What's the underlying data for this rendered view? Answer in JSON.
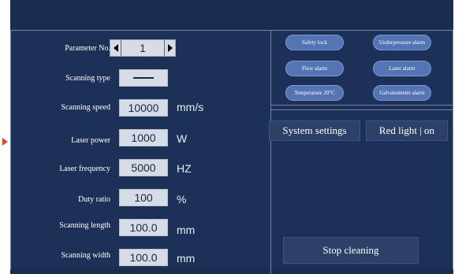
{
  "params": {
    "parameter_no": {
      "label": "Parameter No.",
      "value": "1"
    },
    "scanning_type": {
      "label": "Scanning type"
    },
    "rows": [
      {
        "label": "Scanning speed",
        "value": "10000",
        "unit": "mm/s"
      },
      {
        "label": "Laser power",
        "value": "1000",
        "unit": "W"
      },
      {
        "label": "Laser frequency",
        "value": "5000",
        "unit": "HZ"
      },
      {
        "label": "Duty ratio",
        "value": "100",
        "unit": "%"
      },
      {
        "label": "Scanning length",
        "value": "100.0",
        "unit": "mm"
      },
      {
        "label": "Scanning width",
        "value": "100.0",
        "unit": "mm"
      }
    ]
  },
  "alarms": [
    {
      "label": "Safety lock"
    },
    {
      "label": "Underpressure alarm"
    },
    {
      "label": "Flow alarm"
    },
    {
      "label": "Laser alarm"
    },
    {
      "label": "Temperature 20°C"
    },
    {
      "label": "Galvanometer alarm"
    }
  ],
  "controls": {
    "system_settings": "System settings",
    "red_light": "Red light | on",
    "stop_cleaning": "Stop cleaning"
  },
  "colors": {
    "background": "#1a2c50",
    "panel": "#1d3158",
    "alarm_badge": "#5474b4",
    "value_box": "#d6dce6",
    "pointer_arrow": "#e8491c"
  }
}
